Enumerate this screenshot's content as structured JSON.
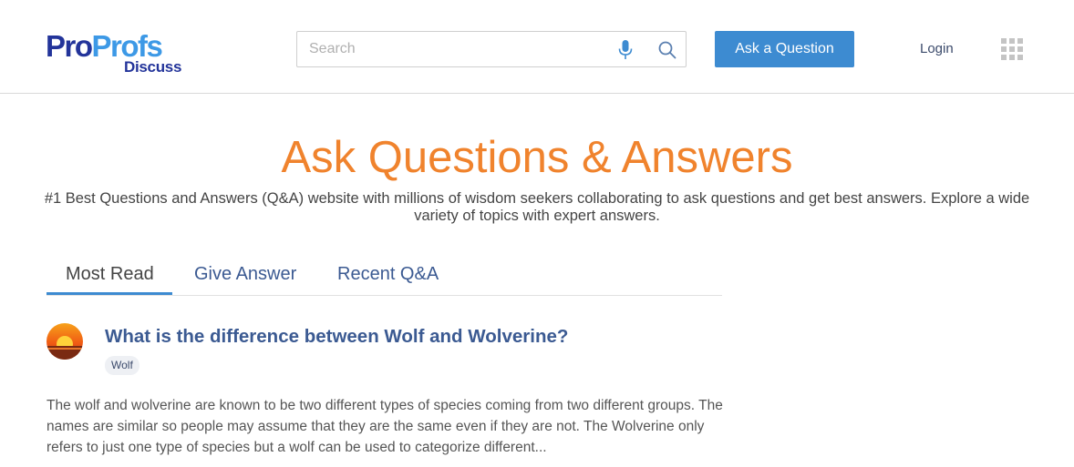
{
  "header": {
    "logo": {
      "brand_pro": "Pro",
      "brand_profs": "Profs",
      "product": "Discuss"
    },
    "search": {
      "placeholder": "Search",
      "value": ""
    },
    "icons": {
      "mic": "microphone-icon",
      "search": "search-icon",
      "apps": "apps-grid-icon"
    },
    "ask_button": "Ask a Question",
    "login": "Login"
  },
  "hero": {
    "title": "Ask Questions & Answers",
    "subtitle": "#1 Best Questions and Answers (Q&A) website with millions of wisdom seekers collaborating to ask questions and get best answers. Explore a wide variety of topics with expert answers."
  },
  "tabs": [
    {
      "label": "Most Read",
      "active": true
    },
    {
      "label": "Give Answer",
      "active": false
    },
    {
      "label": "Recent Q&A",
      "active": false
    }
  ],
  "question": {
    "title": "What is the difference between Wolf and Wolverine?",
    "tag": "Wolf",
    "answer_excerpt": "The wolf and wolverine are known to be two different types of species coming from two different groups. The names are similar so people may assume that they are the same even if they are not. The Wolverine only refers to just one type of species but a wolf can be used to categorize different..."
  },
  "colors": {
    "brand_dark": "#23349a",
    "brand_light": "#3d99e6",
    "accent_orange": "#f0832d",
    "button_blue": "#3d8bd1",
    "link_blue": "#3b5a92"
  }
}
